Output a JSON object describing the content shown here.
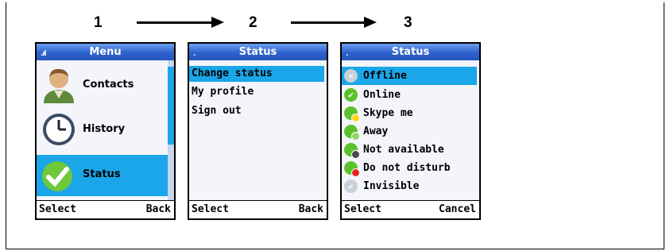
{
  "steps": [
    "1",
    "2",
    "3"
  ],
  "screens": {
    "menu": {
      "title": "Menu",
      "items": [
        {
          "label": "Contacts",
          "icon": "contact-person-icon"
        },
        {
          "label": "History",
          "icon": "clock-icon"
        },
        {
          "label": "Status",
          "icon": "status-check-icon",
          "selected": true
        }
      ],
      "left_softkey": "Select",
      "right_softkey": "Back"
    },
    "status_menu": {
      "title": "Status",
      "items": [
        "Change status",
        "My profile",
        "Sign out"
      ],
      "left_softkey": "Select",
      "right_softkey": "Back"
    },
    "status_list": {
      "title": "Status",
      "items": [
        {
          "label": "Offline",
          "icon": "offline-icon",
          "color": "#b9c0c9"
        },
        {
          "label": "Online",
          "icon": "online-check-icon",
          "color": "#5cc22b"
        },
        {
          "label": "Skype me",
          "icon": "skype-me-icon",
          "color": "#5cc22b"
        },
        {
          "label": "Away",
          "icon": "away-clock-icon",
          "color": "#5cc22b"
        },
        {
          "label": "Not available",
          "icon": "not-available-icon",
          "color": "#5cc22b"
        },
        {
          "label": "Do not disturb",
          "icon": "do-not-disturb-icon",
          "color": "#5cc22b"
        },
        {
          "label": "Invisible",
          "icon": "invisible-icon",
          "color": "#b9c0c9"
        }
      ],
      "left_softkey": "Select",
      "right_softkey": "Cancel"
    }
  },
  "colors": {
    "selection": "#1aa6e8",
    "titlebar": "#2d61cc"
  }
}
